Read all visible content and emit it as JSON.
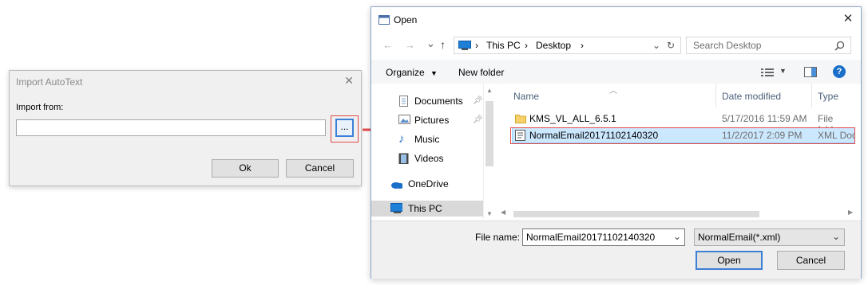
{
  "import_dialog": {
    "title": "Import AutoText",
    "close_glyph": "✕",
    "import_from_label": "Import from:",
    "import_from_value": "",
    "browse_label": "...",
    "ok_label": "Ok",
    "cancel_label": "Cancel"
  },
  "open_dialog": {
    "title": "Open",
    "close_glyph": "✕",
    "nav": {
      "back": "←",
      "forward": "→",
      "recent": "⌄",
      "up": "↑"
    },
    "breadcrumb": [
      "This PC",
      "Desktop"
    ],
    "breadcrumb_sep": "›",
    "search_placeholder": "Search Desktop",
    "toolbar": {
      "organize": "Organize",
      "new_folder": "New folder",
      "help": "?"
    },
    "nav_pane": [
      {
        "label": "Documents",
        "icon": "documents-icon",
        "pinned": true
      },
      {
        "label": "Pictures",
        "icon": "pictures-icon",
        "pinned": true
      },
      {
        "label": "Music",
        "icon": "music-icon",
        "pinned": false
      },
      {
        "label": "Videos",
        "icon": "videos-icon",
        "pinned": false
      },
      {
        "label": "OneDrive",
        "icon": "onedrive-icon",
        "pinned": false
      },
      {
        "label": "This PC",
        "icon": "this-pc-icon",
        "pinned": false,
        "selected": true
      }
    ],
    "columns": [
      "Name",
      "Date modified",
      "Type"
    ],
    "files": [
      {
        "name": "KMS_VL_ALL_6.5.1",
        "date": "5/17/2016 11:59 AM",
        "type": "File folder",
        "icon": "folder-icon"
      },
      {
        "name": "NormalEmail20171102140320",
        "date": "11/2/2017 2:09 PM",
        "type": "XML Docu",
        "icon": "xml-file-icon",
        "selected": true
      }
    ],
    "file_name_label": "File name:",
    "file_name_value": "NormalEmail20171102140320",
    "file_type_value": "NormalEmail(*.xml)",
    "open_label": "Open",
    "cancel_label": "Cancel"
  },
  "colors": {
    "accent": "#3c7fd6",
    "highlight_red": "#e14a4a",
    "selection": "#cce8ff"
  }
}
